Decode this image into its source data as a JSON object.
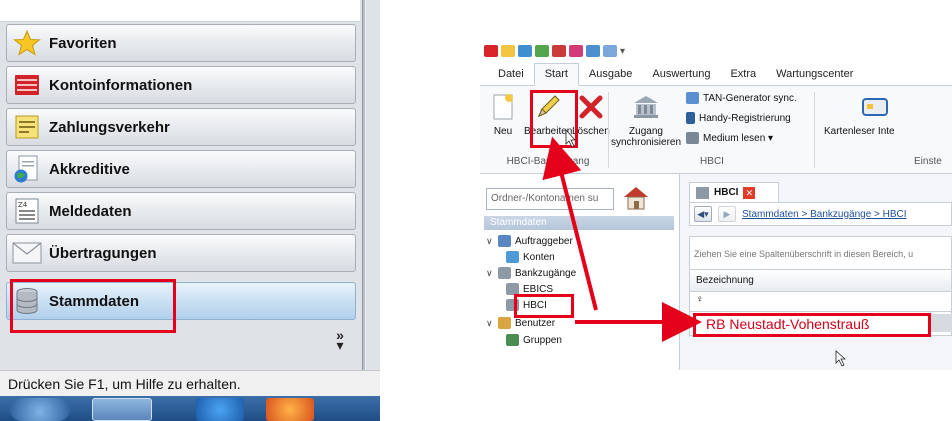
{
  "left_panel": {
    "nav_items": [
      {
        "label": "Favoriten",
        "icon": "star-icon"
      },
      {
        "label": "Kontoinformationen",
        "icon": "account-book-icon"
      },
      {
        "label": "Zahlungsverkehr",
        "icon": "payment-form-icon"
      },
      {
        "label": "Akkreditive",
        "icon": "document-globe-icon"
      },
      {
        "label": "Meldedaten",
        "icon": "report-form-icon"
      },
      {
        "label": "Übertragungen",
        "icon": "envelope-icon"
      },
      {
        "label": "Stammdaten",
        "icon": "database-icon",
        "active": true
      }
    ],
    "more_glyph": "»",
    "status_text": "Drücken Sie F1, um Hilfe zu erhalten."
  },
  "right_panel": {
    "ribbon_tabs": [
      "Datei",
      "Start",
      "Ausgabe",
      "Auswertung",
      "Extra",
      "Wartungscenter"
    ],
    "active_tab": "Start",
    "ribbon": {
      "neu": "Neu",
      "bearbeiten": "Bearbeiten",
      "loeschen": "Löschen",
      "group_bankzugang": "HBCI-Bankzugang",
      "zugang_line1": "Zugang",
      "zugang_line2": "synchronisieren",
      "tan_generator": "TAN-Generator sync.",
      "handy_registrierung": "Handy-Registrierung",
      "medium_lesen": "Medium lesen ▾",
      "group_hbci": "HBCI",
      "kartenleser": "Kartenleser Inte",
      "group_einst": "Einste"
    },
    "search_placeholder": "Ordner-/Kontonamen su",
    "section_header": "Stammdaten",
    "tree": [
      {
        "label": "Auftraggeber",
        "level": 0,
        "expanded": true,
        "icon": "person-icon"
      },
      {
        "label": "Konten",
        "level": 1,
        "icon": "account-icon"
      },
      {
        "label": "Bankzugänge",
        "level": 0,
        "expanded": true,
        "icon": "bank-icon"
      },
      {
        "label": "EBICS",
        "level": 1,
        "icon": "bank-icon"
      },
      {
        "label": "HBCI",
        "level": 1,
        "icon": "bank-icon",
        "selected": true
      },
      {
        "label": "Benutzer",
        "level": 0,
        "expanded": true,
        "icon": "users-icon"
      },
      {
        "label": "Gruppen",
        "level": 1,
        "icon": "group-icon"
      }
    ],
    "doc_tab": "HBCI",
    "breadcrumb": "Stammdaten > Bankzugänge > HBCI",
    "group_hint": "Ziehen Sie eine Spaltenüberschrift in diesen Bereich, u",
    "column_header": "Bezeichnung",
    "filter_glyph": "♀",
    "row_value": "RB Neustadt-Vohenstrauß"
  },
  "colors": {
    "highlight": "#e4001b",
    "nav_active": "#c7def2",
    "link": "#1f4f9a"
  }
}
